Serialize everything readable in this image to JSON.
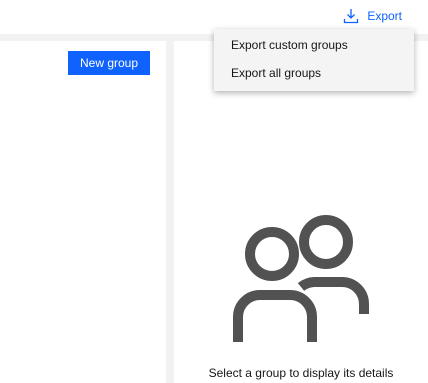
{
  "toolbar": {
    "export_label": "Export",
    "export_icon": "download-icon"
  },
  "left_panel": {
    "new_group_label": "New group"
  },
  "export_menu": {
    "items": [
      {
        "label": "Export custom groups"
      },
      {
        "label": "Export all groups"
      }
    ]
  },
  "details_panel": {
    "empty_icon": "user-group-icon",
    "empty_message": "Select a group to display its details"
  },
  "colors": {
    "accent": "#0f62fe",
    "divider": "#f2f2f2",
    "menu_bg": "#f4f4f4",
    "icon_gray": "#525252"
  }
}
